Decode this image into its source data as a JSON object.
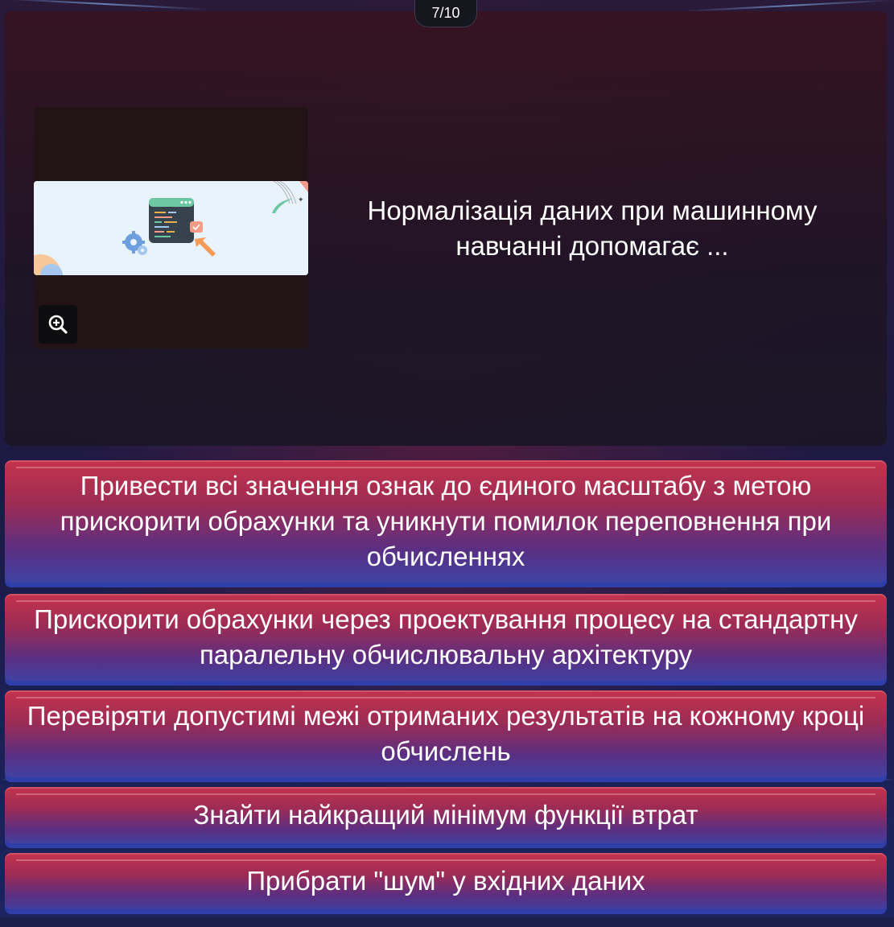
{
  "progress": {
    "label": "7/10",
    "current": 7,
    "total": 10
  },
  "question": {
    "text": "Нормалізація даних при машинному навчанні допомагає ...",
    "image_icon": "code-window-illustration",
    "zoom_icon": "zoom-in-icon"
  },
  "answers": [
    {
      "text": "Привести всі значення ознак до єдиного масштабу з метою прискорити обрахунки та уникнути помилок переповнення при обчисленнях"
    },
    {
      "text": "Прискорити обрахунки через проектування процесу на стандартну паралельну обчислювальну архітектуру"
    },
    {
      "text": "Перевіряти допустимі межі отриманих результатів на кожному кроці обчислень"
    },
    {
      "text": "Знайти найкращий мінімум функції втрат"
    },
    {
      "text": "Прибрати \"шум\" у вхідних даних"
    }
  ],
  "colors": {
    "answer_top": "#c4334c",
    "answer_bottom": "#3b45a8",
    "card_bg": "#2a1620",
    "pill_bg": "#16161e"
  }
}
